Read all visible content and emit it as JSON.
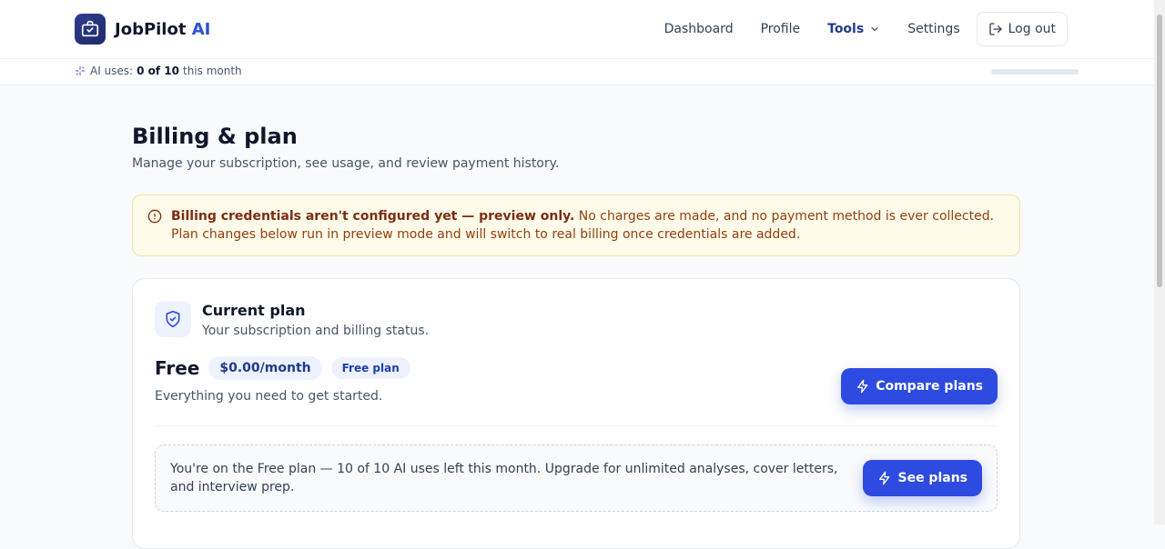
{
  "brand": {
    "name": "JobPilot",
    "accent": "AI"
  },
  "nav": {
    "items": [
      "Dashboard",
      "Profile",
      "Tools",
      "Settings"
    ],
    "logout": "Log out"
  },
  "usage": {
    "label": "AI uses:",
    "used": "0 of 10",
    "suffix": "this month",
    "progress_fraction": 0
  },
  "page": {
    "title": "Billing & plan",
    "subtitle": "Manage your subscription, see usage, and review payment history."
  },
  "alert": {
    "bold": "Billing credentials aren't configured yet — preview only.",
    "text": "No charges are made, and no payment method is ever collected. Plan changes below run in preview mode and will switch to real billing once credentials are added."
  },
  "current_plan": {
    "title": "Current plan",
    "subtitle": "Your subscription and billing status.",
    "plan_name": "Free",
    "price": "$0.00/month",
    "badge": "Free plan",
    "description": "Everything you need to get started.",
    "compare_button": "Compare plans",
    "note": "You're on the Free plan — 10 of 10 AI uses left this month. Upgrade for unlimited analyses, cover letters, and interview prep.",
    "see_button": "See plans"
  },
  "colors": {
    "accent": "#2f4fd8",
    "primary_button": "#2d4be0",
    "alert_bg": "#fefbea",
    "alert_text": "#92400e"
  },
  "icons": [
    "briefcase-logo-icon",
    "chevron-down-icon",
    "logout-icon",
    "sparkle-icon",
    "alert-circle-icon",
    "shield-check-icon",
    "lightning-icon"
  ]
}
